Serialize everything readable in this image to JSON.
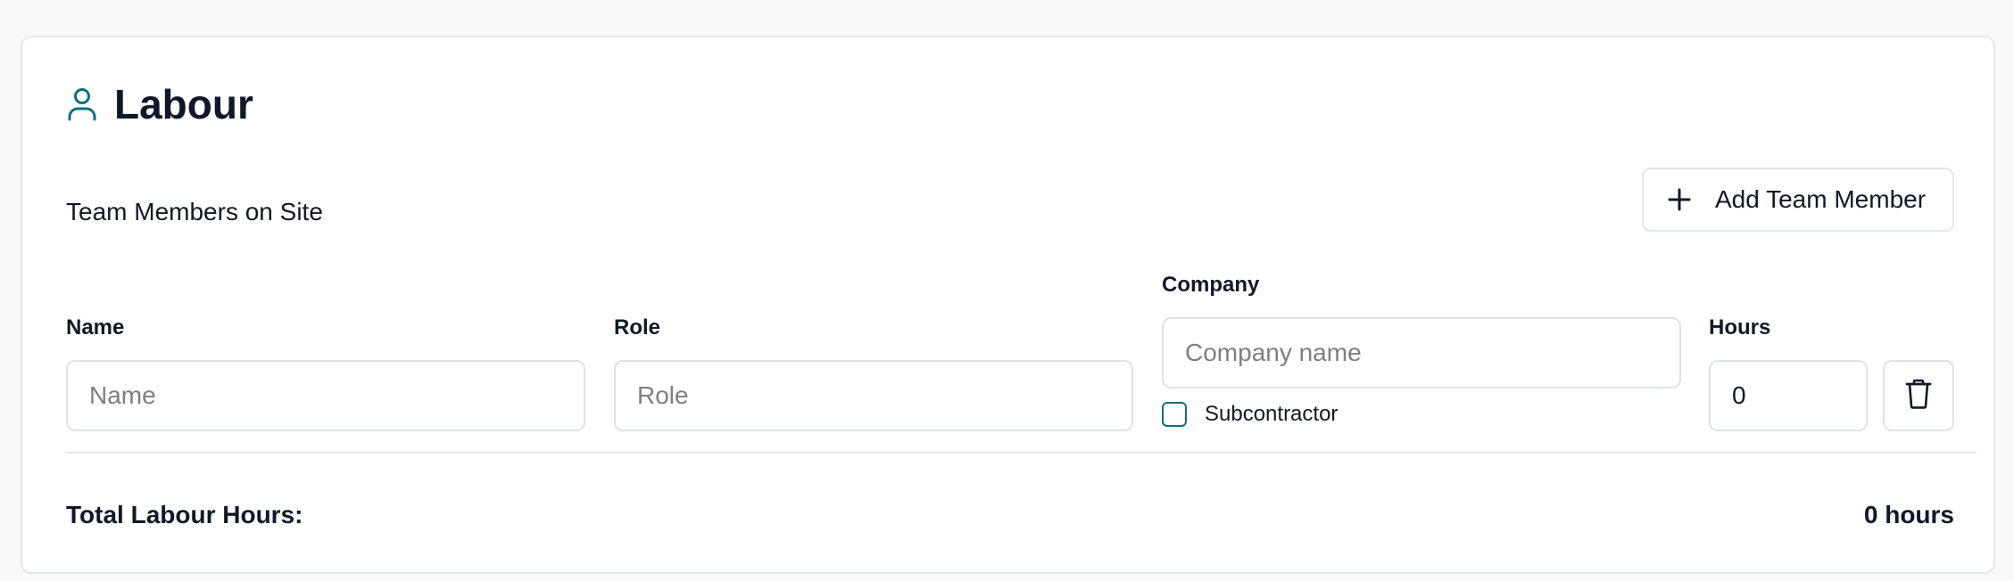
{
  "section": {
    "title": "Labour",
    "icon": "user-icon",
    "accent_color": "#0e6f7a"
  },
  "team": {
    "subtitle": "Team Members on Site",
    "add_button_label": "Add Team Member",
    "add_button_icon": "plus-icon"
  },
  "member_row": {
    "name": {
      "label": "Name",
      "placeholder": "Name",
      "value": ""
    },
    "role": {
      "label": "Role",
      "placeholder": "Role",
      "value": ""
    },
    "company": {
      "label": "Company",
      "placeholder": "Company name",
      "value": ""
    },
    "subcontractor": {
      "label": "Subcontractor",
      "checked": false
    },
    "hours": {
      "label": "Hours",
      "value": "0"
    },
    "delete_icon": "trash-icon"
  },
  "total": {
    "label": "Total Labour Hours:",
    "value": "0 hours"
  }
}
